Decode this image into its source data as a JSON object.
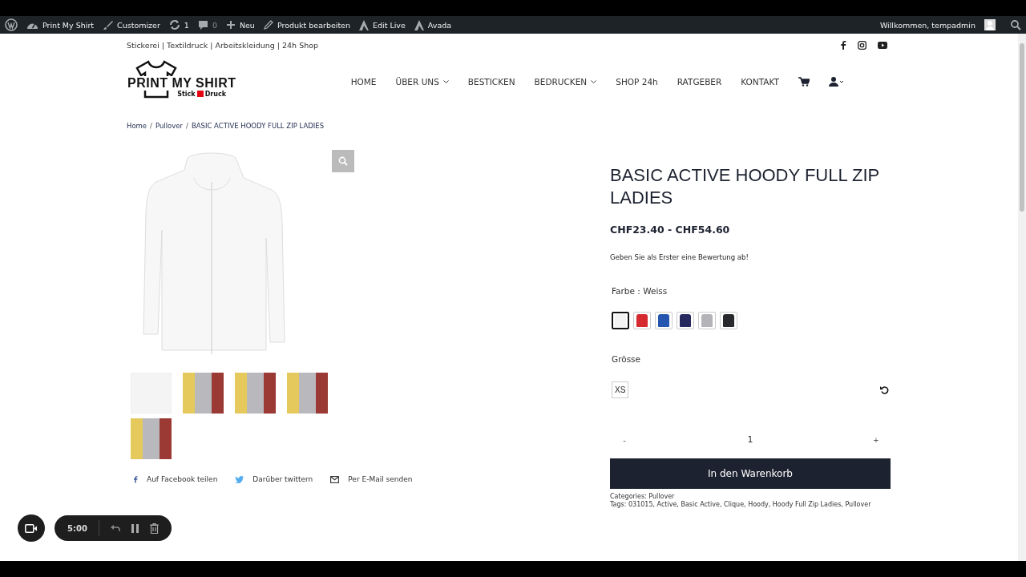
{
  "admin_bar": {
    "items": [
      {
        "kind": "wp"
      },
      {
        "kind": "dashboard",
        "label": "Print My Shirt"
      },
      {
        "kind": "brush",
        "label": "Customizer"
      },
      {
        "kind": "update",
        "label": "1"
      },
      {
        "kind": "comment",
        "label": "0"
      },
      {
        "kind": "plus",
        "label": "Neu"
      },
      {
        "kind": "pencil",
        "label": "Produkt bearbeiten"
      },
      {
        "kind": "avada",
        "label": "Edit Live"
      },
      {
        "kind": "avada",
        "label": "Avada"
      }
    ],
    "greeting": "Willkommen, tempadmin"
  },
  "top_line": "Stickerei | Textildruck | Arbeitskleidung | 24h Shop",
  "logo": {
    "title": "PRINT MY SHIRT",
    "subtitle_left": "Stick",
    "subtitle_right": "Druck"
  },
  "nav": [
    {
      "label": "HOME",
      "dropdown": false
    },
    {
      "label": "ÜBER UNS",
      "dropdown": true
    },
    {
      "label": "BESTICKEN",
      "dropdown": false
    },
    {
      "label": "BEDRUCKEN",
      "dropdown": true
    },
    {
      "label": "SHOP 24h",
      "dropdown": false
    },
    {
      "label": "RATGEBER",
      "dropdown": false
    },
    {
      "label": "KONTAKT",
      "dropdown": false
    }
  ],
  "breadcrumb": {
    "separator": "/",
    "items": [
      "Home",
      "Pullover",
      "BASIC ACTIVE HOODY FULL ZIP LADIES"
    ]
  },
  "product": {
    "title": "BASIC ACTIVE HOODY FULL ZIP LADIES",
    "price": "CHF23.40 - CHF54.60",
    "review_prompt": "Geben Sie als Erster eine Bewertung ab!",
    "color_label": "Farbe : Weiss",
    "swatches": [
      {
        "color": "#f2f2f2",
        "selected": true
      },
      {
        "color": "#d42a30",
        "selected": false
      },
      {
        "color": "#2456b0",
        "selected": false
      },
      {
        "color": "#26295e",
        "selected": false
      },
      {
        "color": "#b4b4b8",
        "selected": false
      },
      {
        "color": "#27292c",
        "selected": false
      }
    ],
    "size_label": "Grösse",
    "sizes": [
      {
        "label": "XS",
        "selected": false
      }
    ],
    "minus": "-",
    "quantity": "1",
    "plus": "+",
    "cart_button": "In den Warenkorb",
    "categories": "Categories: Pullover",
    "tags": "Tags: 031015, Active, Basic Active, Clique, Hoody, Hoody Full Zip Ladies, Pullover"
  },
  "thumbnails": [
    {
      "kind": "product"
    },
    {
      "kind": "photo"
    },
    {
      "kind": "photo"
    },
    {
      "kind": "photo"
    },
    {
      "kind": "photo"
    }
  ],
  "share": [
    {
      "kind": "facebook",
      "label": "Auf Facebook teilen"
    },
    {
      "kind": "twitter",
      "label": "Darüber twittern"
    },
    {
      "kind": "email",
      "label": "Per E-Mail senden"
    }
  ],
  "recorder": {
    "time": "5:00"
  }
}
